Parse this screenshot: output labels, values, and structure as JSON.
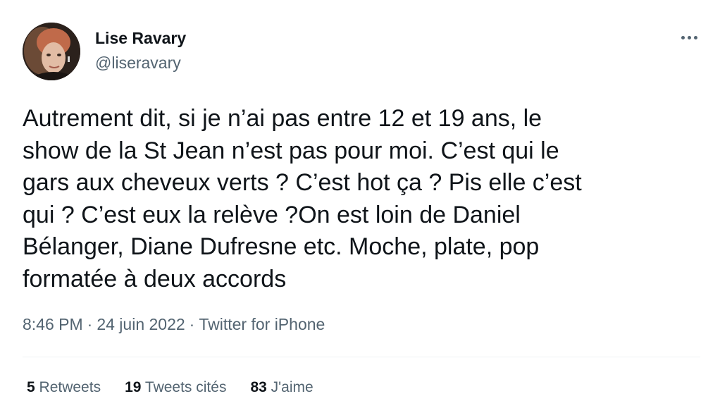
{
  "author": {
    "display_name": "Lise Ravary",
    "handle": "@liseravary"
  },
  "tweet": {
    "text": "Autrement dit, si je n’ai pas entre 12 et 19 ans, le\nshow de la St Jean n’est pas pour moi. C’est qui le\ngars aux cheveux verts ? C’est hot ça ? Pis elle c’est\nqui ? C’est eux la relève ?On est loin de Daniel\nBélanger, Diane Dufresne etc. Moche, plate, pop\nformatée à deux accords",
    "time": "8:46 PM",
    "date": "24 juin 2022",
    "source": "Twitter for iPhone",
    "separator": "·"
  },
  "stats": {
    "retweets_count": "5",
    "retweets_label": "Retweets",
    "quotes_count": "19",
    "quotes_label": "Tweets cités",
    "likes_count": "83",
    "likes_label": "J'aime"
  },
  "icons": {
    "more": "more-options-icon"
  }
}
